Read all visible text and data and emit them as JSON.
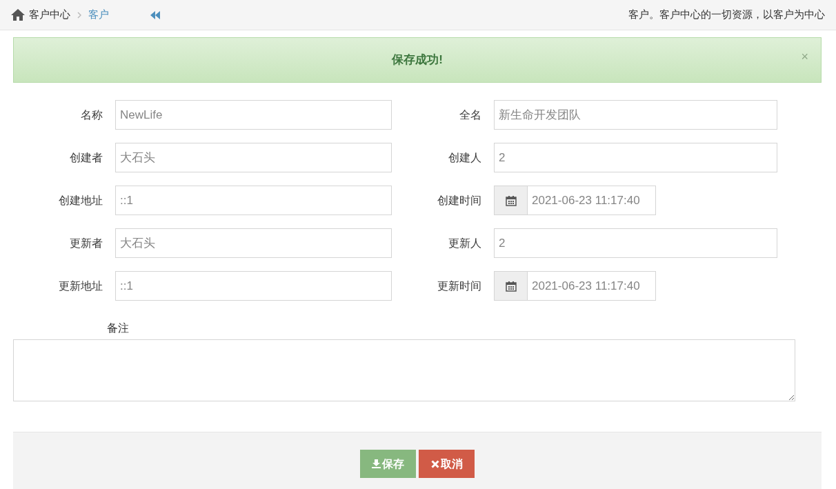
{
  "breadcrumb": [
    {
      "label": "客户中心",
      "kind": "home"
    },
    {
      "label": "客户",
      "kind": "current"
    }
  ],
  "page_description": "客户。客户中心的一切资源，以客户为中心",
  "alert": {
    "message": "保存成功!",
    "close": "×"
  },
  "fields": [
    {
      "label": "名称",
      "value": "NewLife",
      "kind": "text"
    },
    {
      "label": "全名",
      "value": "新生命开发团队",
      "kind": "text"
    },
    {
      "label": "创建者",
      "value": "大石头",
      "kind": "text"
    },
    {
      "label": "创建人",
      "value": "2",
      "kind": "text"
    },
    {
      "label": "创建地址",
      "value": "::1",
      "kind": "text"
    },
    {
      "label": "创建时间",
      "value": "2021-06-23 11:17:40",
      "kind": "datetime"
    },
    {
      "label": "更新者",
      "value": "大石头",
      "kind": "text"
    },
    {
      "label": "更新人",
      "value": "2",
      "kind": "text"
    },
    {
      "label": "更新地址",
      "value": "::1",
      "kind": "text"
    },
    {
      "label": "更新时间",
      "value": "2021-06-23 11:17:40",
      "kind": "datetime"
    }
  ],
  "remark": {
    "label": "备注"
  },
  "buttons": [
    {
      "label": "保存",
      "kind": "save"
    },
    {
      "label": "取消",
      "kind": "cancel"
    }
  ]
}
